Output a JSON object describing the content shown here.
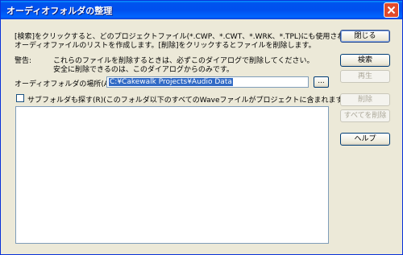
{
  "window": {
    "title": "オーディオフォルダの整理"
  },
  "description": {
    "line1": "[検索]をクリックすると、どのプロジェクトファイル(*.CWP、*.CWT、*.WRK、*.TPL)にも使用されていない",
    "line2": "オーディオファイルのリストを作成します。[削除]をクリックするとファイルを削除します。"
  },
  "warning": {
    "label": "警告:",
    "line1": "これらのファイルを削除するときは、必ずこのダイアログで削除してください。",
    "line2": "安全に削除できるのは、このダイアログからのみです。"
  },
  "folder": {
    "label": "オーディオフォルダの場所(A):",
    "value": "C:¥Cakewalk Projects¥Audio Data",
    "browse_label": "..."
  },
  "subfolder": {
    "label": "サブフォルダも探す(R)(このフォルダ以下のすべてのWaveファイルがプロジェクトに含まれます)",
    "checked": false
  },
  "file_list": {
    "items": []
  },
  "buttons": {
    "close": "閉じる",
    "search": "検索",
    "play": "再生",
    "delete": "削除",
    "delete_all": "すべてを削除",
    "help": "ヘルプ"
  }
}
